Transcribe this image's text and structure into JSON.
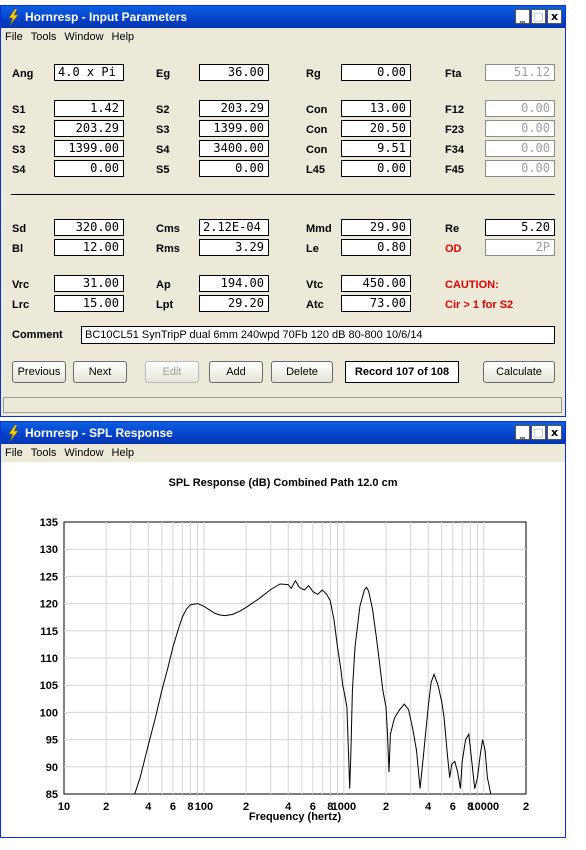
{
  "window1": {
    "title": "Hornresp - Input Parameters",
    "menu": [
      "File",
      "Tools",
      "Window",
      "Help"
    ],
    "controls": {
      "min": "_",
      "max": "□",
      "close": "x"
    },
    "params": {
      "Ang": "4.0 x Pi",
      "Eg": "36.00",
      "Rg": "0.00",
      "Fta": "51.12",
      "S1": "1.42",
      "S2a": "203.29",
      "Con1": "13.00",
      "F12": "0.00",
      "S2": "203.29",
      "S3a": "1399.00",
      "Con2": "20.50",
      "F23": "0.00",
      "S3": "1399.00",
      "S4a": "3400.00",
      "Con3": "9.51",
      "F34": "0.00",
      "S4": "0.00",
      "S5": "0.00",
      "L45": "0.00",
      "F45": "0.00",
      "Sd": "320.00",
      "Cms": "2.12E-04",
      "Mmd": "29.90",
      "Re": "5.20",
      "Bl": "12.00",
      "Rms": "3.29",
      "Le": "0.80",
      "OD": "2P",
      "Vrc": "31.00",
      "Ap": "194.00",
      "Vtc": "450.00",
      "Lrc": "15.00",
      "Lpt": "29.20",
      "Atc": "73.00"
    },
    "labels": {
      "Ang": "Ang",
      "Eg": "Eg",
      "Rg": "Rg",
      "Fta": "Fta",
      "S1": "S1",
      "S2": "S2",
      "S3": "S3",
      "S4": "S4",
      "S5": "S5",
      "Con": "Con",
      "L45": "L45",
      "F12": "F12",
      "F23": "F23",
      "F34": "F34",
      "F45": "F45",
      "Sd": "Sd",
      "Cms": "Cms",
      "Mmd": "Mmd",
      "Re": "Re",
      "Bl": "Bl",
      "Rms": "Rms",
      "Le": "Le",
      "OD": "OD",
      "Vrc": "Vrc",
      "Ap": "Ap",
      "Vtc": "Vtc",
      "Lrc": "Lrc",
      "Lpt": "Lpt",
      "Atc": "Atc",
      "caution": "CAUTION:",
      "caution_detail": "Cir > 1 for S2"
    },
    "comment_label": "Comment",
    "comment": "BC10CL51 SynTripP dual  6mm 240wpd 70Fb 120 dB 80-800 10/6/14",
    "buttons": {
      "previous": "Previous",
      "next": "Next",
      "edit": "Edit",
      "add": "Add",
      "delete": "Delete",
      "calculate": "Calculate"
    },
    "record": "Record 107 of 108"
  },
  "window2": {
    "title": "Hornresp - SPL Response",
    "menu": [
      "File",
      "Tools",
      "Window",
      "Help"
    ],
    "controls": {
      "min": "_",
      "max": "□",
      "close": "x"
    }
  },
  "chart_data": {
    "type": "line",
    "title": "SPL Response (dB)   Combined   Path 12.0 cm",
    "xlabel": "Frequency (hertz)",
    "ylabel": "",
    "x_scale": "log",
    "xlim": [
      10,
      20000
    ],
    "ylim": [
      85,
      135
    ],
    "yticks": [
      85,
      90,
      95,
      100,
      105,
      110,
      115,
      120,
      125,
      130,
      135
    ],
    "xtick_labels": [
      {
        "f": 10,
        "label": "10"
      },
      {
        "f": 20,
        "label": "2"
      },
      {
        "f": 40,
        "label": "4"
      },
      {
        "f": 60,
        "label": "6"
      },
      {
        "f": 80,
        "label": "8"
      },
      {
        "f": 100,
        "label": "100"
      },
      {
        "f": 200,
        "label": "2"
      },
      {
        "f": 400,
        "label": "4"
      },
      {
        "f": 600,
        "label": "6"
      },
      {
        "f": 800,
        "label": "8"
      },
      {
        "f": 1000,
        "label": "1000"
      },
      {
        "f": 2000,
        "label": "2"
      },
      {
        "f": 4000,
        "label": "4"
      },
      {
        "f": 6000,
        "label": "6"
      },
      {
        "f": 8000,
        "label": "8"
      },
      {
        "f": 10000,
        "label": "10000"
      },
      {
        "f": 20000,
        "label": "2"
      }
    ],
    "grid": true,
    "series": [
      {
        "name": "",
        "points": [
          [
            32,
            85
          ],
          [
            35,
            88
          ],
          [
            40,
            94
          ],
          [
            45,
            99
          ],
          [
            50,
            104
          ],
          [
            55,
            108
          ],
          [
            60,
            112
          ],
          [
            65,
            115
          ],
          [
            70,
            117.5
          ],
          [
            75,
            119
          ],
          [
            80,
            119.8
          ],
          [
            90,
            120
          ],
          [
            100,
            119.5
          ],
          [
            110,
            118.8
          ],
          [
            120,
            118.2
          ],
          [
            130,
            117.9
          ],
          [
            140,
            117.8
          ],
          [
            160,
            118
          ],
          [
            180,
            118.6
          ],
          [
            200,
            119.3
          ],
          [
            250,
            121
          ],
          [
            300,
            122.6
          ],
          [
            350,
            123.6
          ],
          [
            400,
            123.5
          ],
          [
            420,
            122.8
          ],
          [
            450,
            124.2
          ],
          [
            480,
            123
          ],
          [
            520,
            122.5
          ],
          [
            560,
            123.3
          ],
          [
            600,
            122.2
          ],
          [
            650,
            121.7
          ],
          [
            700,
            122.5
          ],
          [
            750,
            121.8
          ],
          [
            800,
            120.5
          ],
          [
            850,
            117
          ],
          [
            900,
            112
          ],
          [
            950,
            108
          ],
          [
            980,
            105
          ],
          [
            1000,
            104
          ],
          [
            1050,
            101
          ],
          [
            1080,
            92
          ],
          [
            1100,
            86
          ],
          [
            1120,
            92
          ],
          [
            1150,
            104
          ],
          [
            1200,
            112
          ],
          [
            1300,
            119.5
          ],
          [
            1400,
            122.5
          ],
          [
            1450,
            123
          ],
          [
            1500,
            122.3
          ],
          [
            1600,
            119
          ],
          [
            1700,
            114
          ],
          [
            1800,
            109
          ],
          [
            1900,
            104
          ],
          [
            2000,
            101
          ],
          [
            2050,
            96
          ],
          [
            2100,
            89
          ],
          [
            2150,
            96
          ],
          [
            2300,
            99
          ],
          [
            2500,
            100.5
          ],
          [
            2700,
            101.5
          ],
          [
            2900,
            100.5
          ],
          [
            3100,
            97
          ],
          [
            3300,
            93
          ],
          [
            3500,
            86
          ],
          [
            3700,
            92
          ],
          [
            4000,
            101
          ],
          [
            4200,
            105.5
          ],
          [
            4400,
            107
          ],
          [
            4700,
            105
          ],
          [
            5000,
            102
          ],
          [
            5200,
            99
          ],
          [
            5500,
            92
          ],
          [
            5700,
            88
          ],
          [
            5900,
            90.5
          ],
          [
            6200,
            91
          ],
          [
            6500,
            89
          ],
          [
            6800,
            86
          ],
          [
            7000,
            91
          ],
          [
            7400,
            95
          ],
          [
            7800,
            96
          ],
          [
            8200,
            91
          ],
          [
            8600,
            86
          ],
          [
            9000,
            88
          ],
          [
            9400,
            92
          ],
          [
            9800,
            95
          ],
          [
            10200,
            93
          ],
          [
            10600,
            88
          ],
          [
            11200,
            85
          ]
        ]
      }
    ]
  }
}
